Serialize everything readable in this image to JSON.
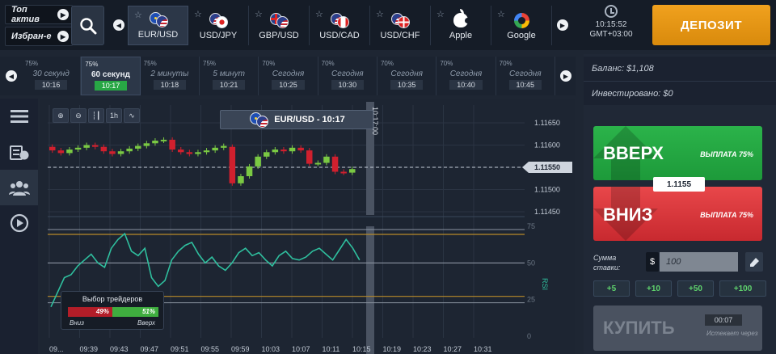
{
  "asset_tabs": [
    {
      "label": "Топ актив"
    },
    {
      "label": "Избран-е"
    }
  ],
  "assets": [
    {
      "label": "EUR/USD",
      "icon": "eur-usd-flags-icon",
      "active": true
    },
    {
      "label": "USD/JPY",
      "icon": "usd-jpy-flags-icon"
    },
    {
      "label": "GBP/USD",
      "icon": "gbp-usd-flags-icon"
    },
    {
      "label": "USD/CAD",
      "icon": "usd-cad-flags-icon"
    },
    {
      "label": "USD/CHF",
      "icon": "usd-chf-flags-icon"
    },
    {
      "label": "Apple",
      "icon": "apple-logo-icon"
    },
    {
      "label": "Google",
      "icon": "google-logo-icon"
    }
  ],
  "clock": {
    "time": "10:15:52",
    "tz": "GMT+03:00"
  },
  "deposit_label": "ДЕПОЗИТ",
  "expiries": [
    {
      "pct": "75%",
      "name": "30 секунд",
      "time": "10:16"
    },
    {
      "pct": "75%",
      "name": "60 секунд",
      "time": "10:17",
      "active": true
    },
    {
      "pct": "75%",
      "name": "2 минуты",
      "time": "10:18"
    },
    {
      "pct": "75%",
      "name": "5 минут",
      "time": "10:21"
    },
    {
      "pct": "70%",
      "name": "Сегодня",
      "time": "10:25"
    },
    {
      "pct": "70%",
      "name": "Сегодня",
      "time": "10:30"
    },
    {
      "pct": "70%",
      "name": "Сегодня",
      "time": "10:35"
    },
    {
      "pct": "70%",
      "name": "Сегодня",
      "time": "10:40"
    },
    {
      "pct": "70%",
      "name": "Сегодня",
      "time": "10:45"
    }
  ],
  "chart": {
    "pair_tag": "EUR/USD - 10:17",
    "expiry_marker": "10:17:00",
    "current_price": "1.11550",
    "price_ticks": [
      "1.11650",
      "1.11600",
      "1.11550",
      "1.11500",
      "1.11450"
    ],
    "rsi_ticks": [
      "75",
      "50",
      "25",
      "0"
    ],
    "rsi_label": "RSI",
    "time_ticks": [
      "09...",
      "09:39",
      "09:43",
      "09:47",
      "09:51",
      "09:55",
      "09:59",
      "10:03",
      "10:07",
      "10:11",
      "10:15",
      "10:19",
      "10:23",
      "10:27",
      "10:31"
    ],
    "tools": [
      "zoom-in-icon",
      "zoom-out-icon",
      "candles-icon",
      "1h",
      "line-type-icon"
    ],
    "candles": [
      [
        1.11596,
        1.11588
      ],
      [
        1.11588,
        1.11582
      ],
      [
        1.11582,
        1.1159
      ],
      [
        1.1159,
        1.11594
      ],
      [
        1.11594,
        1.116
      ],
      [
        1.116,
        1.11596
      ],
      [
        1.11596,
        1.11586
      ],
      [
        1.11586,
        1.1158
      ],
      [
        1.1158,
        1.11586
      ],
      [
        1.11586,
        1.11592
      ],
      [
        1.11592,
        1.11598
      ],
      [
        1.11598,
        1.11604
      ],
      [
        1.11604,
        1.1161
      ],
      [
        1.1161,
        1.11612
      ],
      [
        1.11612,
        1.1159
      ],
      [
        1.1159,
        1.11584
      ],
      [
        1.11584,
        1.1158
      ],
      [
        1.1158,
        1.11584
      ],
      [
        1.11584,
        1.11588
      ],
      [
        1.11588,
        1.11594
      ],
      [
        1.11594,
        1.11598
      ],
      [
        1.11596,
        1.11514
      ],
      [
        1.11514,
        1.1153
      ],
      [
        1.1153,
        1.11552
      ],
      [
        1.11552,
        1.11574
      ],
      [
        1.11574,
        1.11584
      ],
      [
        1.11584,
        1.1159
      ],
      [
        1.1159,
        1.11586
      ],
      [
        1.11586,
        1.11594
      ],
      [
        1.11594,
        1.11588
      ],
      [
        1.11588,
        1.11558
      ],
      [
        1.11558,
        1.1156
      ],
      [
        1.1156,
        1.11574
      ],
      [
        1.11574,
        1.1154
      ],
      [
        1.1154,
        1.11538
      ],
      [
        1.11538,
        1.11546
      ]
    ],
    "rsi": [
      20,
      30,
      40,
      42,
      48,
      52,
      56,
      50,
      47,
      60,
      66,
      70,
      58,
      55,
      60,
      40,
      34,
      38,
      52,
      58,
      62,
      64,
      56,
      50,
      54,
      48,
      45,
      50,
      57,
      60,
      55,
      57,
      52,
      48,
      55,
      58,
      53,
      52,
      54,
      58,
      60,
      56,
      52,
      59,
      66,
      60,
      52
    ]
  },
  "voting": {
    "title": "Выбор трейдеров",
    "down_pct": "49%",
    "up_pct": "51%",
    "down_label": "Вниз",
    "up_label": "Вверх",
    "down_frac": 0.49
  },
  "account": {
    "balance": "Баланс: $1,108",
    "invested": "Инвестировано: $0"
  },
  "trade": {
    "up_label": "ВВЕРХ",
    "up_payout": "ВЫПЛАТА 75%",
    "down_label": "ВНИЗ",
    "down_payout": "ВЫПЛАТА 75%",
    "current_price": "1.1155",
    "stake_label": "Сумма ставки:",
    "currency": "$",
    "stake_value": "100",
    "quick": [
      "+5",
      "+10",
      "+50",
      "+100"
    ],
    "buy_label": "КУПИТЬ",
    "buy_timer": "00:07",
    "buy_timer_label": "Истекает через"
  },
  "colors": {
    "up": "#2bb34a",
    "down": "#e0383d",
    "accent": "#f0a11e",
    "rsi_line": "#2fbf9e"
  }
}
